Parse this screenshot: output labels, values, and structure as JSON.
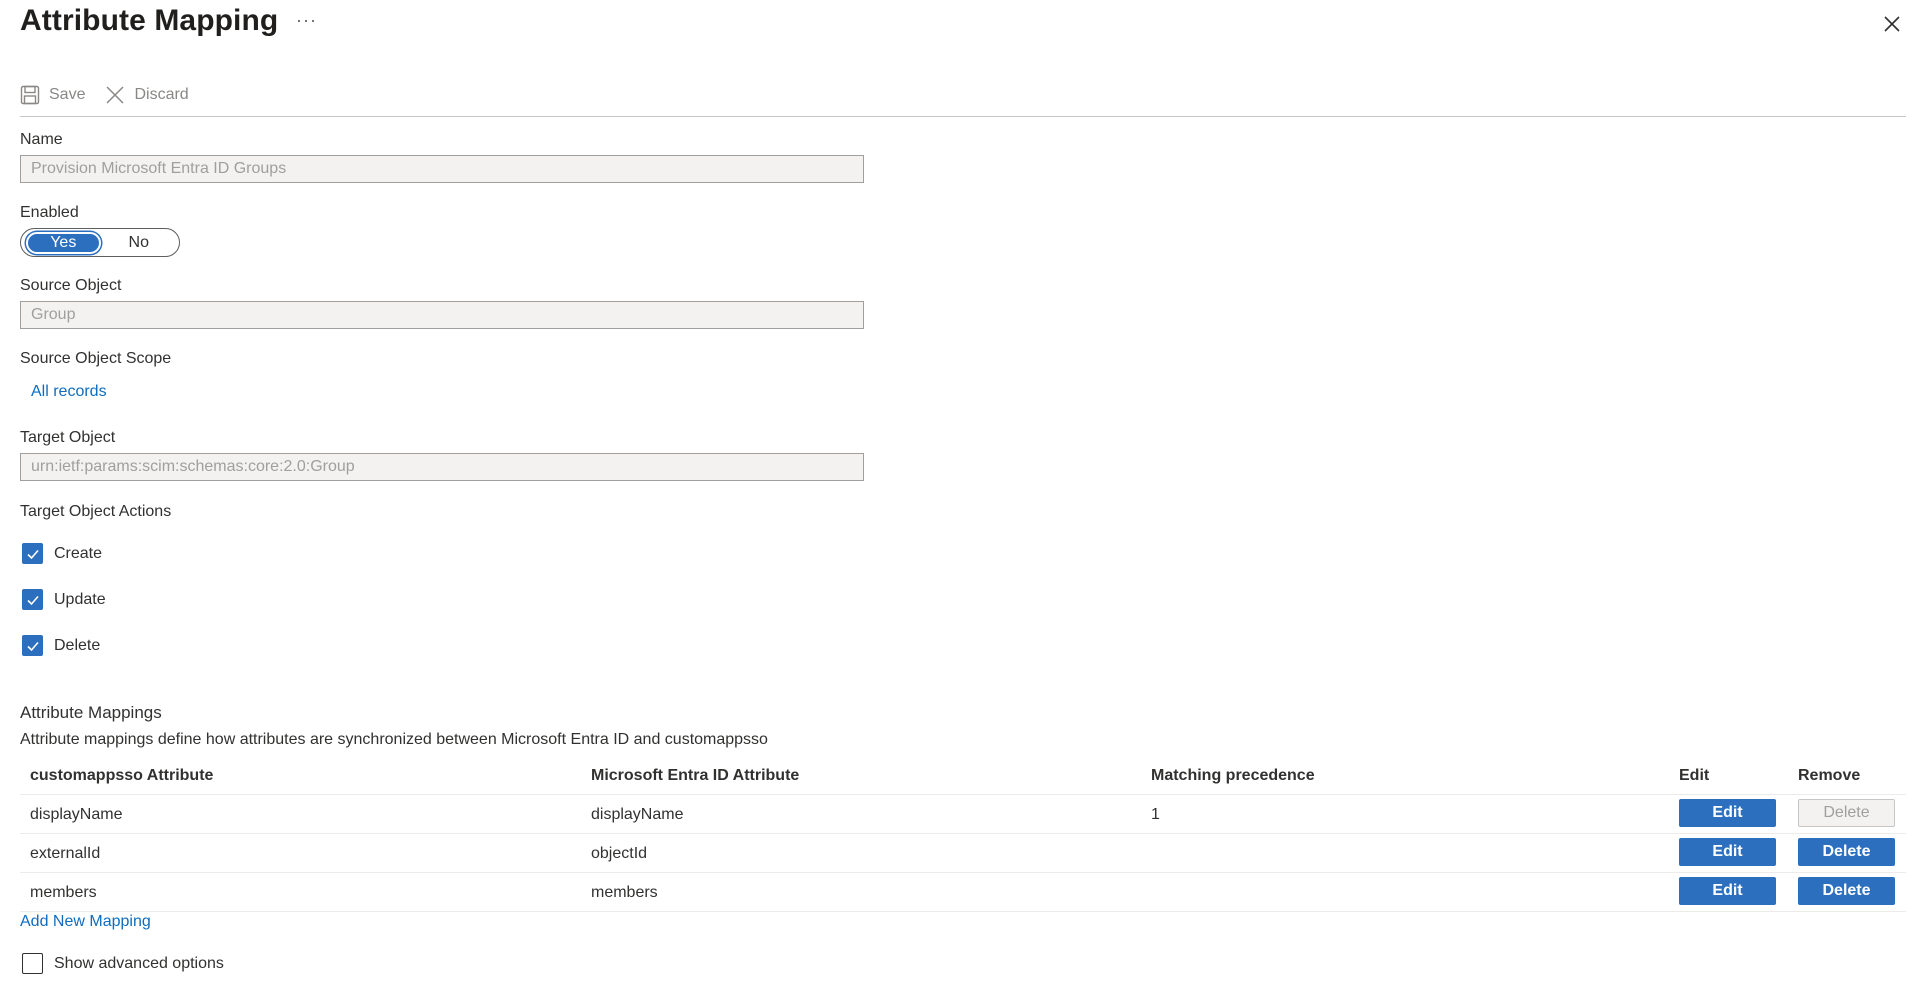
{
  "header": {
    "title": "Attribute Mapping",
    "more": "···"
  },
  "toolbar": {
    "save_label": "Save",
    "discard_label": "Discard"
  },
  "form": {
    "name_label": "Name",
    "name_value": "Provision Microsoft Entra ID Groups",
    "enabled_label": "Enabled",
    "enabled_yes": "Yes",
    "enabled_no": "No",
    "enabled_selected": "Yes",
    "source_object_label": "Source Object",
    "source_object_value": "Group",
    "source_scope_label": "Source Object Scope",
    "source_scope_link": "All records",
    "target_object_label": "Target Object",
    "target_object_value": "urn:ietf:params:scim:schemas:core:2.0:Group",
    "target_actions_label": "Target Object Actions",
    "actions": [
      {
        "label": "Create",
        "checked": true
      },
      {
        "label": "Update",
        "checked": true
      },
      {
        "label": "Delete",
        "checked": true
      }
    ]
  },
  "mappings": {
    "title": "Attribute Mappings",
    "description": "Attribute mappings define how attributes are synchronized between Microsoft Entra ID and customappsso",
    "columns": [
      "customappsso Attribute",
      "Microsoft Entra ID Attribute",
      "Matching precedence",
      "Edit",
      "Remove"
    ],
    "rows": [
      {
        "target": "displayName",
        "source": "displayName",
        "precedence": "1",
        "edit": "Edit",
        "remove": "Delete",
        "remove_disabled": true
      },
      {
        "target": "externalId",
        "source": "objectId",
        "precedence": "",
        "edit": "Edit",
        "remove": "Delete",
        "remove_disabled": false
      },
      {
        "target": "members",
        "source": "members",
        "precedence": "",
        "edit": "Edit",
        "remove": "Delete",
        "remove_disabled": false
      }
    ],
    "add_link": "Add New Mapping"
  },
  "advanced": {
    "label": "Show advanced options",
    "checked": false
  },
  "colors": {
    "accent": "#2c6fbf",
    "link": "#0f6cbd",
    "disabled_bg": "#f3f2f1"
  }
}
